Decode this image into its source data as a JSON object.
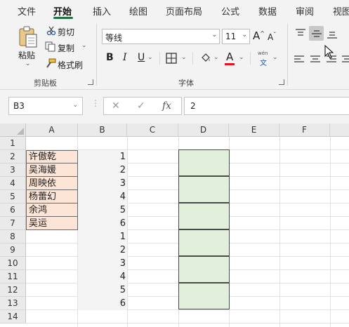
{
  "ribbon_tabs": [
    "文件",
    "开始",
    "插入",
    "绘图",
    "页面布局",
    "公式",
    "数据",
    "审阅",
    "视图"
  ],
  "active_tab": "开始",
  "clipboard": {
    "paste": "粘贴",
    "cut": "剪切",
    "copy": "复制",
    "format_painter": "格式刷",
    "group": "剪贴板"
  },
  "font": {
    "name": "等线",
    "size": "11",
    "grow": "A",
    "shrink": "A",
    "bold": "B",
    "italic": "I",
    "underline": "U",
    "font_color": "A",
    "phonetic_top": "wén",
    "phonetic_bottom": "文",
    "group": "字体",
    "font_color_bar": "#e81123"
  },
  "formula_bar": {
    "name_box": "B3",
    "cancel": "✕",
    "enter": "✓",
    "fx": "fx",
    "value": "2"
  },
  "columns": [
    "A",
    "B",
    "C",
    "D",
    "E",
    "F"
  ],
  "rows": [
    "1",
    "2",
    "3",
    "4",
    "5",
    "6",
    "7",
    "8",
    "9",
    "10",
    "11",
    "12",
    "13",
    "14"
  ],
  "col_a": [
    "许傲乾",
    "吴海媛",
    "周映依",
    "杨蕾幻",
    "余鸿",
    "吴运"
  ],
  "col_b": [
    "1",
    "2",
    "3",
    "4",
    "5",
    "6",
    "1",
    "2",
    "3",
    "4",
    "5",
    "6"
  ],
  "colors": {
    "accent": "#217346",
    "name_fill": "#fce4d6",
    "merged_fill": "#e2efda"
  }
}
